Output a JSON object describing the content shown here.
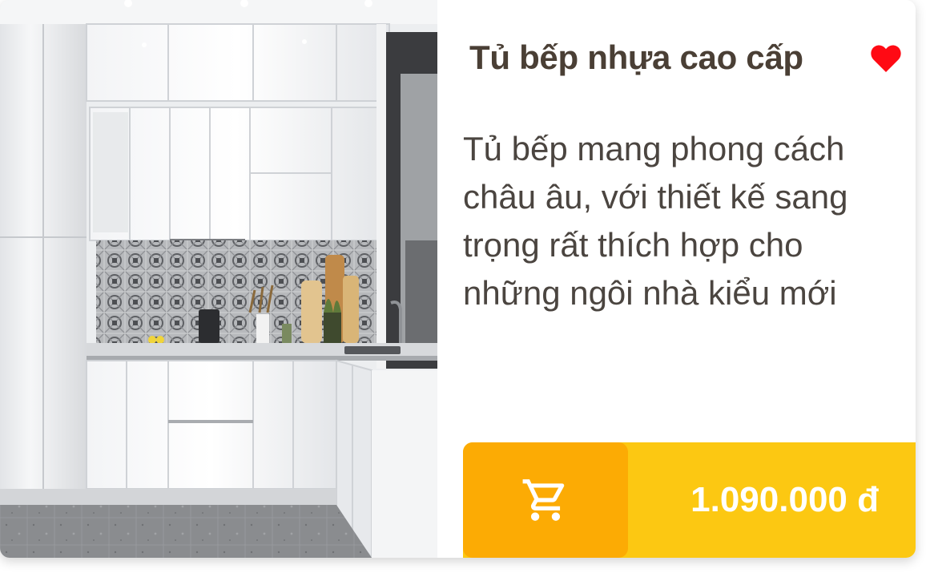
{
  "product": {
    "name": "Tủ bếp nhựa cao cấp",
    "description": "Tủ bếp mang phong cách châu âu, với thiết kế sang trọng rất thích hợp cho những ngôi nhà kiểu mới",
    "price": "1.090.000 đ",
    "favorited": true,
    "image_alt": "White glossy kitchen cabinets with patterned grey tile backsplash"
  },
  "icons": {
    "favorite": "heart-icon",
    "cart": "shopping-cart-icon"
  },
  "colors": {
    "title": "#4a3f35",
    "text": "#4b4540",
    "heart": "#ff0a14",
    "cart_button": "#fcab04",
    "price_bar": "#fcc812",
    "price_text": "#ffffff"
  }
}
